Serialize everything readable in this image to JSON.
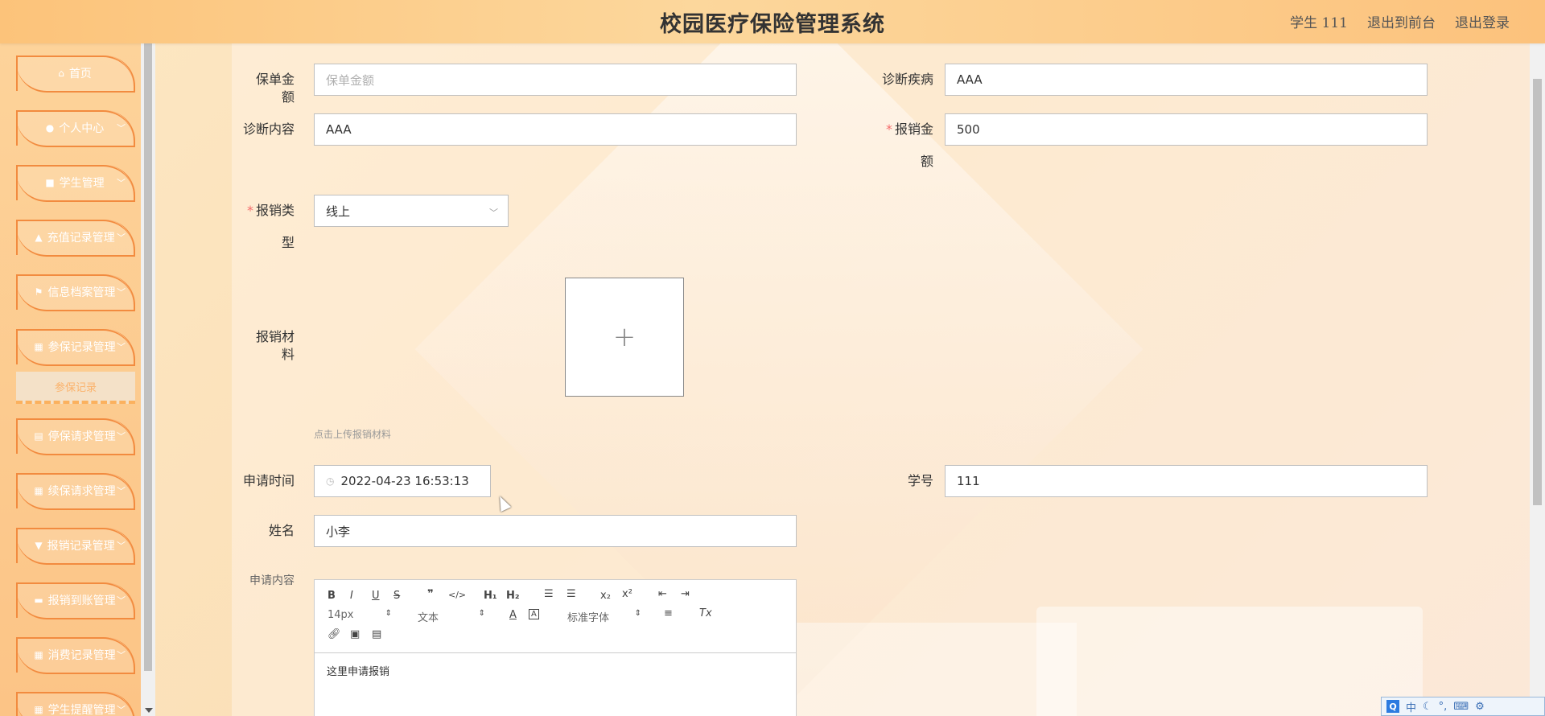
{
  "header": {
    "title": "校园医疗保险管理系统",
    "user_label": "学生 111",
    "to_front": "退出到前台",
    "logout": "退出登录"
  },
  "sidebar": {
    "items": [
      {
        "label": "首页",
        "icon": "home-icon",
        "has_arrow": false
      },
      {
        "label": "个人中心",
        "icon": "user-icon",
        "has_arrow": true
      },
      {
        "label": "学生管理",
        "icon": "briefcase-icon",
        "has_arrow": true
      },
      {
        "label": "充值记录管理",
        "icon": "thumbs-up-icon",
        "has_arrow": true
      },
      {
        "label": "信息档案管理",
        "icon": "flag-icon",
        "has_arrow": true
      },
      {
        "label": "参保记录管理",
        "icon": "grid-icon",
        "has_arrow": true
      },
      {
        "label": "停保请求管理",
        "icon": "clipboard-icon",
        "has_arrow": true
      },
      {
        "label": "续保请求管理",
        "icon": "grid-icon",
        "has_arrow": true
      },
      {
        "label": "报销记录管理",
        "icon": "trophy-icon",
        "has_arrow": true
      },
      {
        "label": "报销到账管理",
        "icon": "wallet-icon",
        "has_arrow": true
      },
      {
        "label": "消费记录管理",
        "icon": "grid-icon",
        "has_arrow": true
      },
      {
        "label": "学生提醒管理",
        "icon": "bell-icon",
        "has_arrow": true
      }
    ],
    "active_submenu": "参保记录"
  },
  "form": {
    "policy_amount_label": "保单金额",
    "policy_amount_placeholder": "保单金额",
    "diagnosis_disease_label": "诊断疾病",
    "diagnosis_disease_value": "AAA",
    "diagnosis_content_label": "诊断内容",
    "diagnosis_content_value": "AAA",
    "claim_amount_label_1": "报销金",
    "claim_amount_label_2": "额",
    "claim_amount_value": "500",
    "claim_type_label_1": "报销类",
    "claim_type_label_2": "型",
    "claim_type_value": "线上",
    "claim_material_label": "报销材料",
    "upload_tip": "点击上传报销材料",
    "apply_time_label": "申请时间",
    "apply_time_value": "2022-04-23 16:53:13",
    "student_no_label": "学号",
    "student_no_value": "111",
    "name_label": "姓名",
    "name_value": "小李",
    "apply_content_label": "申请内容"
  },
  "editor": {
    "font_size": "14px",
    "heading": "文本",
    "font_family": "标准字体",
    "content": "这里申请报销"
  },
  "colors": {
    "header_bg": "#fcc37a",
    "sidebar_bg": "#fbb05e",
    "menu_border": "#f28b3f",
    "required": "#f56c6c"
  }
}
